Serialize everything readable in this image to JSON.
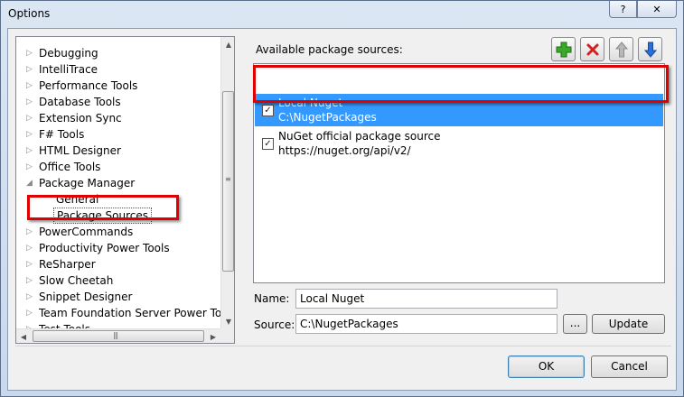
{
  "window": {
    "title": "Options",
    "help_glyph": "?",
    "close_glyph": "✕"
  },
  "tree": {
    "items": [
      {
        "label": "Debugging",
        "expander": "collapsed"
      },
      {
        "label": "IntelliTrace",
        "expander": "collapsed"
      },
      {
        "label": "Performance Tools",
        "expander": "collapsed"
      },
      {
        "label": "Database Tools",
        "expander": "collapsed"
      },
      {
        "label": "Extension Sync",
        "expander": "collapsed"
      },
      {
        "label": "F# Tools",
        "expander": "collapsed"
      },
      {
        "label": "HTML Designer",
        "expander": "collapsed"
      },
      {
        "label": "Office Tools",
        "expander": "collapsed"
      },
      {
        "label": "Package Manager",
        "expander": "expanded"
      },
      {
        "label": "General",
        "expander": "none"
      },
      {
        "label": "Package Sources",
        "expander": "none",
        "selected": true
      },
      {
        "label": "PowerCommands",
        "expander": "collapsed"
      },
      {
        "label": "Productivity Power Tools",
        "expander": "collapsed"
      },
      {
        "label": "ReSharper",
        "expander": "collapsed"
      },
      {
        "label": "Slow Cheetah",
        "expander": "collapsed"
      },
      {
        "label": "Snippet Designer",
        "expander": "collapsed"
      },
      {
        "label": "Team Foundation Server Power Tools",
        "expander": "collapsed"
      },
      {
        "label": "Test Tools",
        "expander": "collapsed"
      }
    ]
  },
  "sources_panel": {
    "label": "Available package sources:",
    "sources": [
      {
        "name": "Local Nuget",
        "path": "C:\\NugetPackages",
        "checked": true,
        "selected": true
      },
      {
        "name": "NuGet official package source",
        "path": "https://nuget.org/api/v2/",
        "checked": true,
        "selected": false
      }
    ],
    "toolbar": {
      "add_icon": "add-icon",
      "remove_icon": "remove-icon",
      "up_icon": "move-up-icon",
      "down_icon": "move-down-icon"
    }
  },
  "form": {
    "name_label": "Name:",
    "name_value": "Local Nuget",
    "source_label": "Source:",
    "source_value": "C:\\NugetPackages",
    "browse_label": "...",
    "update_label": "Update"
  },
  "footer": {
    "ok_label": "OK",
    "cancel_label": "Cancel"
  },
  "colors": {
    "selection": "#3399ff",
    "highlight_box": "#e10000",
    "add_green": "#3aa829",
    "remove_red": "#d32020",
    "arrow_blue": "#2a6fd6"
  }
}
